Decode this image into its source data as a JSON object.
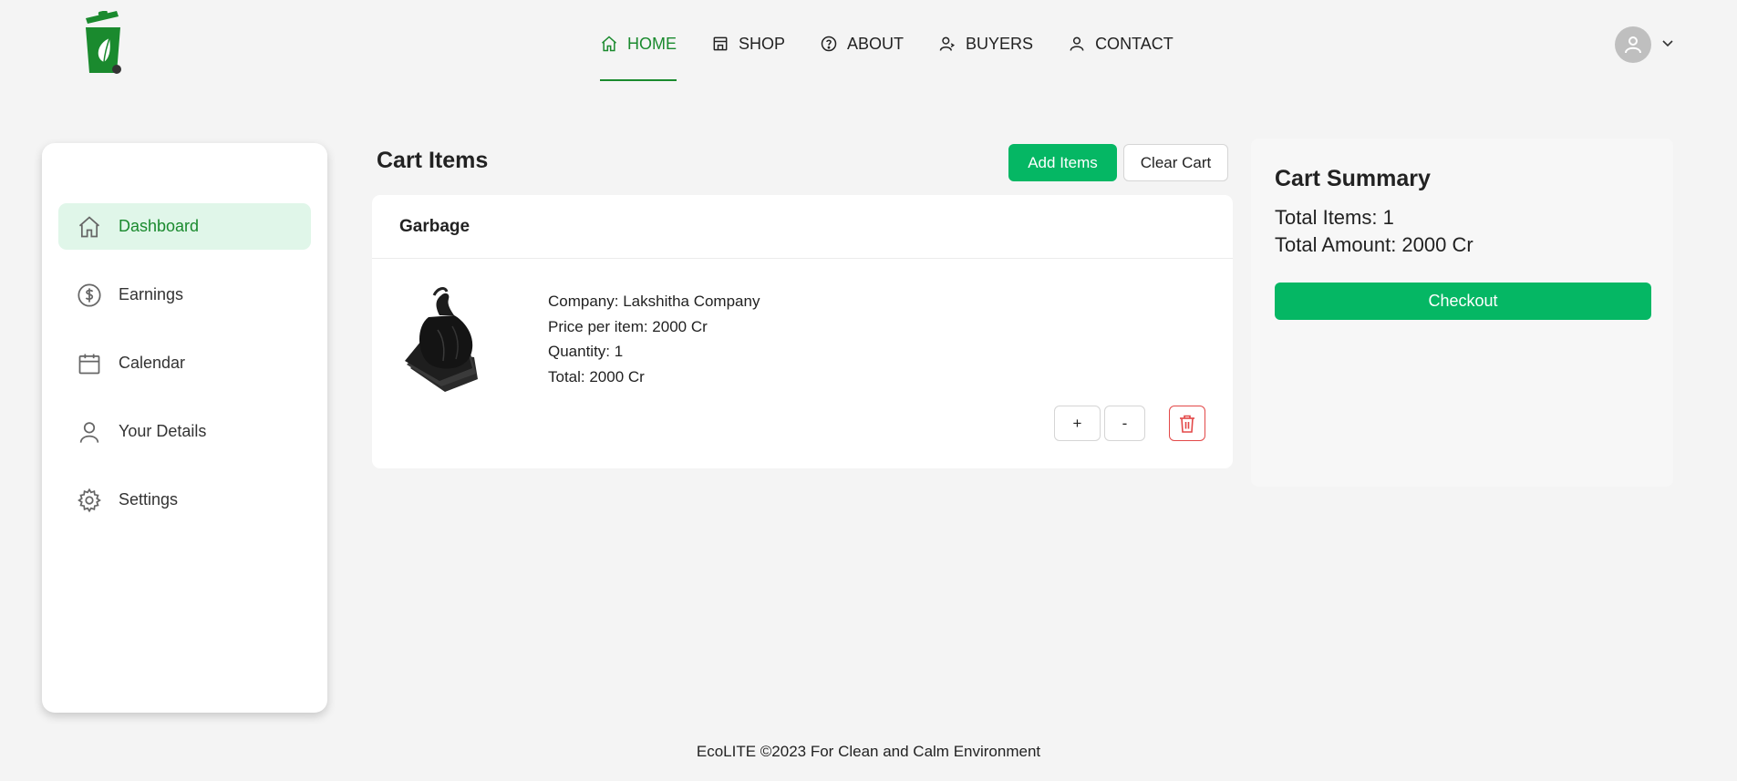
{
  "header": {
    "logo": "eco-trash-bin-logo",
    "nav": [
      {
        "label": "HOME",
        "icon": "home-icon"
      },
      {
        "label": "SHOP",
        "icon": "shop-icon"
      },
      {
        "label": "ABOUT",
        "icon": "help-circle-icon"
      },
      {
        "label": "BUYERS",
        "icon": "user-buyers-icon"
      },
      {
        "label": "CONTACT",
        "icon": "user-contact-icon"
      }
    ],
    "active_nav": "HOME"
  },
  "sidebar": {
    "items": [
      {
        "label": "Dashboard",
        "icon": "home-icon"
      },
      {
        "label": "Earnings",
        "icon": "dollar-icon"
      },
      {
        "label": "Calendar",
        "icon": "calendar-icon"
      },
      {
        "label": "Your Details",
        "icon": "user-icon"
      },
      {
        "label": "Settings",
        "icon": "gear-icon"
      }
    ],
    "active": "Dashboard"
  },
  "cart": {
    "title": "Cart Items",
    "add_label": "Add Items",
    "clear_label": "Clear Cart",
    "items": [
      {
        "name": "Garbage",
        "company": "Company: Lakshitha Company",
        "price": "Price per item: 2000 Cr",
        "quantity": "Quantity: 1",
        "total": "Total: 2000 Cr",
        "plus_label": "+",
        "minus_label": "-"
      }
    ]
  },
  "summary": {
    "title": "Cart Summary",
    "total_items": "Total Items: 1",
    "total_amount": "Total Amount: 2000 Cr",
    "checkout_label": "Checkout"
  },
  "footer": {
    "text": "EcoLITE ©2023 For Clean and Calm Environment"
  },
  "colors": {
    "accent": "#05b764",
    "active_text": "#1a8a2e",
    "active_bg": "#e0f6e9",
    "danger": "#e34848",
    "background": "#f4f4f4"
  }
}
